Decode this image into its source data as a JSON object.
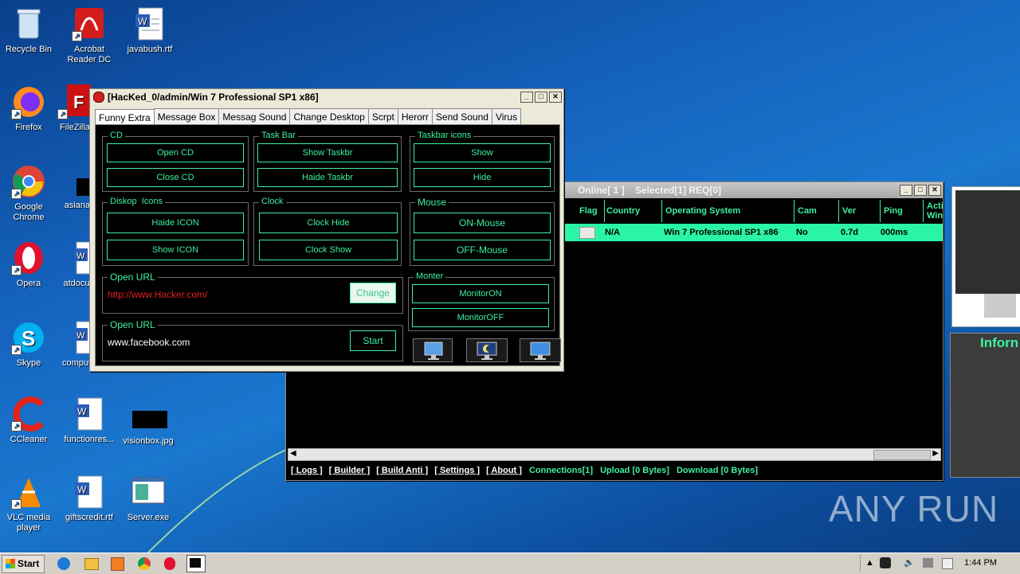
{
  "desktop": {
    "icons": [
      {
        "label": "Recycle Bin"
      },
      {
        "label": "Acrobat Reader DC"
      },
      {
        "label": "javabush.rtf"
      },
      {
        "label": "Firefox"
      },
      {
        "label": "FileZilla"
      },
      {
        "label": "Google Chrome"
      },
      {
        "label": "asianaq"
      },
      {
        "label": "Opera"
      },
      {
        "label": "atdocu"
      },
      {
        "label": "Skype"
      },
      {
        "label": "comput"
      },
      {
        "label": "CCleaner"
      },
      {
        "label": "functionres..."
      },
      {
        "label": "visionbox.jpg"
      },
      {
        "label": "VLC media player"
      },
      {
        "label": "giftscredit.rtf"
      },
      {
        "label": "Server.exe"
      }
    ],
    "watermark": "ANY RUN"
  },
  "main_window": {
    "title": "Online[ 1 ]    Selected[1] REQ[0]",
    "columns": [
      "Flag",
      "Country",
      "Operating System",
      "Cam",
      "Ver",
      "Ping",
      "Acti Win"
    ],
    "rows": [
      {
        "flag": "",
        "country": "N/A",
        "os": "Win 7 Professional SP1 x86",
        "cam": "No",
        "ver": "0.7d",
        "ping": "000ms",
        "active": ""
      }
    ],
    "status": {
      "logs": "[ Logs ]",
      "builder": "[ Builder ]",
      "build_anti": "[ Build Anti ]",
      "settings": "[ Settings ]",
      "about": "[ About ]",
      "connections": "Connections[1]",
      "upload": "Upload [0 Bytes]",
      "download": "Download [0 Bytes]"
    }
  },
  "dialog": {
    "title": "[HacKed_0/admin/Win 7 Professional SP1 x86]",
    "tabs": [
      "Funny Extra",
      "Message Box",
      "Messag Sound",
      "Change Desktop",
      "Scrpt",
      "Herorr",
      "Send Sound",
      "Virus"
    ],
    "groups": {
      "cd": {
        "label": "CD",
        "open": "Open CD",
        "close": "Close CD"
      },
      "taskbar": {
        "label": "Task Bar",
        "show": "Show Taskbr",
        "hide": "Haide Taskbr"
      },
      "taskbar_icons": {
        "label": "Taskbar icons",
        "show": "Show",
        "hide": "Hide"
      },
      "desktop_icons": {
        "label": "Diskop  Icons",
        "hide": "Haide ICON",
        "show": "Show ICON"
      },
      "clock": {
        "label": "Clock",
        "hide": "Clock Hide",
        "show": "Clock Show"
      },
      "mouse": {
        "label": "Mouse",
        "on": "ON-Mouse",
        "off": "OFF-Mouse"
      },
      "open_url_1": {
        "label": "Open URL",
        "url": "http://www.Hacker.com/",
        "button": "Change"
      },
      "monitor": {
        "label": "Monter",
        "on": "MonitorON",
        "off": "MonitorOFF"
      },
      "open_url_2": {
        "label": "Open URL",
        "url": "www.facebook.com",
        "button": "Start"
      }
    }
  },
  "side_panel": {
    "label": "Inforn"
  },
  "taskbar": {
    "start": "Start",
    "time": "1:44 PM"
  },
  "colors": {
    "accent": "#3ef0a0",
    "row_bg": "#2af5a5",
    "url_red": "#e02020"
  }
}
